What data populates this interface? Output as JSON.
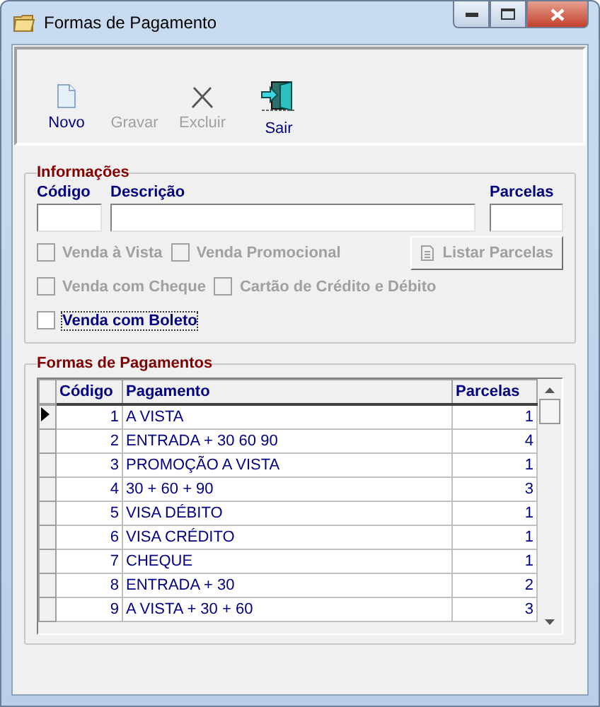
{
  "window": {
    "title": "Formas de Pagamento"
  },
  "toolbar": [
    {
      "label": "Novo",
      "kind": "new",
      "disabled": false
    },
    {
      "label": "Gravar",
      "kind": "save",
      "disabled": true
    },
    {
      "label": "Excluir",
      "kind": "delete",
      "disabled": true
    },
    {
      "label": "Sair",
      "kind": "exit",
      "disabled": false
    }
  ],
  "info": {
    "title": "Informações",
    "fields": [
      {
        "label": "Código"
      },
      {
        "label": "Descrição"
      },
      {
        "label": "Parcelas"
      }
    ],
    "options": [
      {
        "label": "Venda à Vista",
        "checked": false,
        "disabled": true
      },
      {
        "label": "Venda Promocional",
        "checked": false,
        "disabled": true
      },
      {
        "label": "Venda com Cheque",
        "checked": false,
        "disabled": true
      },
      {
        "label": "Cartão de Crédito e Débito",
        "checked": false,
        "disabled": true
      },
      {
        "label": "Venda com Boleto",
        "checked": false,
        "disabled": false
      }
    ],
    "list_button": {
      "label": "Listar Parcelas",
      "disabled": true
    }
  },
  "grid": {
    "title": "Formas de Pagamentos",
    "columns": [
      "Código",
      "Pagamento",
      "Parcelas"
    ],
    "rows": [
      {
        "cells": [
          "1",
          "A VISTA",
          "1"
        ],
        "selected": true
      },
      {
        "cells": [
          "2",
          "ENTRADA + 30 60 90",
          "4"
        ],
        "selected": false
      },
      {
        "cells": [
          "3",
          "PROMOÇÃO A VISTA",
          "1"
        ],
        "selected": false
      },
      {
        "cells": [
          "4",
          "30 + 60 + 90",
          "3"
        ],
        "selected": false
      },
      {
        "cells": [
          "5",
          "VISA DÉBITO",
          "1"
        ],
        "selected": false
      },
      {
        "cells": [
          "6",
          "VISA CRÉDITO",
          "1"
        ],
        "selected": false
      },
      {
        "cells": [
          "7",
          "CHEQUE",
          "1"
        ],
        "selected": false
      },
      {
        "cells": [
          "8",
          "ENTRADA + 30",
          "2"
        ],
        "selected": false
      },
      {
        "cells": [
          "9",
          "A VISTA + 30 + 60",
          "3"
        ],
        "selected": false
      }
    ]
  }
}
